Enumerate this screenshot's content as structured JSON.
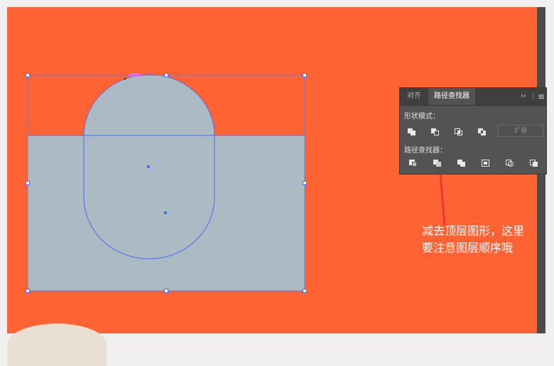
{
  "panel": {
    "tabs": [
      {
        "label": "对齐"
      },
      {
        "label": "路径查找器"
      }
    ],
    "collapse_glyph": "››",
    "menu_glyph": "≡",
    "shape_modes_label": "形状模式：",
    "expand_label": "扩展",
    "pathfinders_label": "路径查找器：",
    "shape_mode_icons": [
      "unite-icon",
      "minus-front-icon",
      "intersect-icon",
      "exclude-icon"
    ],
    "pathfinder_icons": [
      "divide-icon",
      "trim-icon",
      "merge-icon",
      "crop-icon",
      "outline-icon",
      "minus-back-icon"
    ]
  },
  "annotation": {
    "line1": "减去顶层图形，这里",
    "line2": "要注意图层顺序哦"
  },
  "colors": {
    "canvas": "#ff6233",
    "shape_fill": "#abbac3",
    "selection": "#4b6cf6",
    "arrow": "#f03030",
    "panel_bg": "#535353"
  }
}
